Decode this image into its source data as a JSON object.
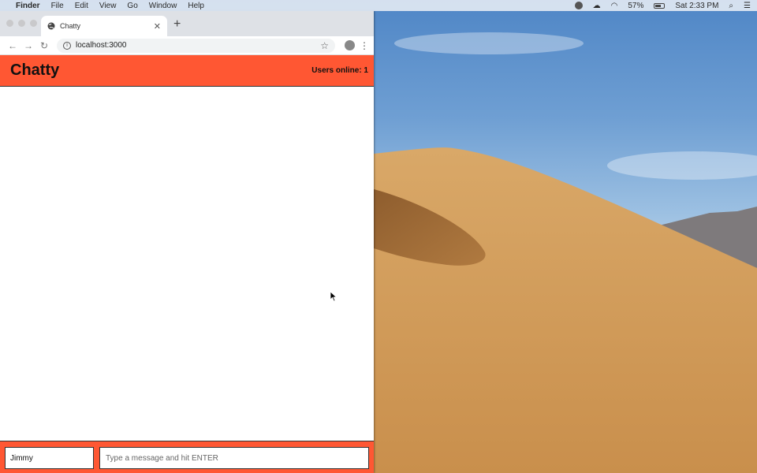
{
  "menubar": {
    "apple_icon": "apple-icon",
    "items": [
      "Finder",
      "File",
      "Edit",
      "View",
      "Go",
      "Window",
      "Help"
    ],
    "battery": "57%",
    "clock": "Sat 2:33 PM"
  },
  "browser": {
    "tab_title": "Chatty",
    "url": "localhost:3000"
  },
  "app": {
    "title": "Chatty",
    "users_online": "Users online: 1",
    "username_value": "Jimmy",
    "message_placeholder": "Type a message and hit ENTER"
  },
  "colors": {
    "header": "#ff5733",
    "footer": "#ff5733"
  }
}
